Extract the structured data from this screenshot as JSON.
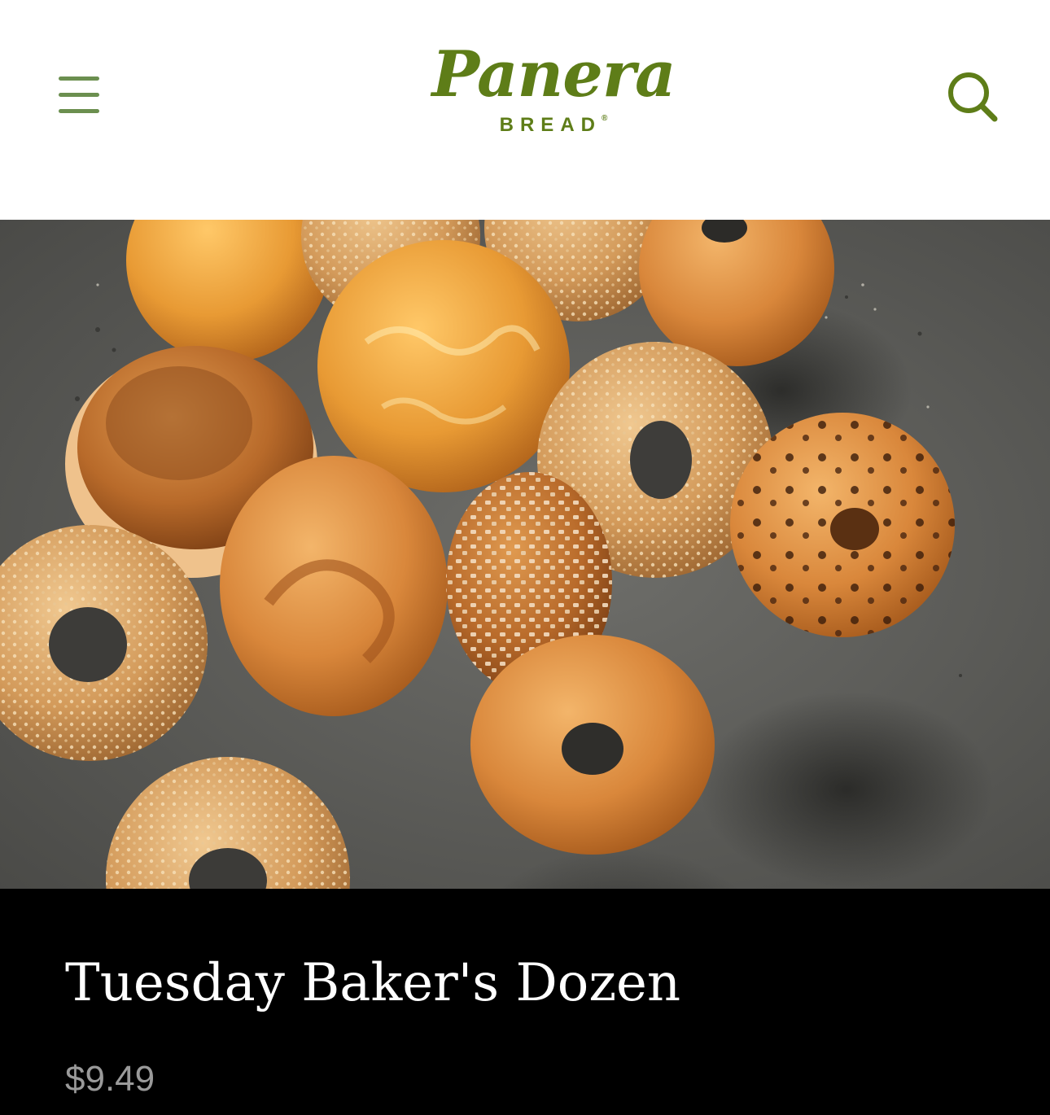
{
  "header": {
    "brand_script": "Panera",
    "brand_sub": "BREAD",
    "brand_mark": "®",
    "menu_icon": "hamburger-menu-icon",
    "search_icon": "search-icon",
    "accent_color": "#5e7d18"
  },
  "hero": {
    "image_subject": "assorted bagels on a grey surface"
  },
  "product": {
    "title": "Tuesday Baker's Dozen",
    "price": "$9.49"
  }
}
